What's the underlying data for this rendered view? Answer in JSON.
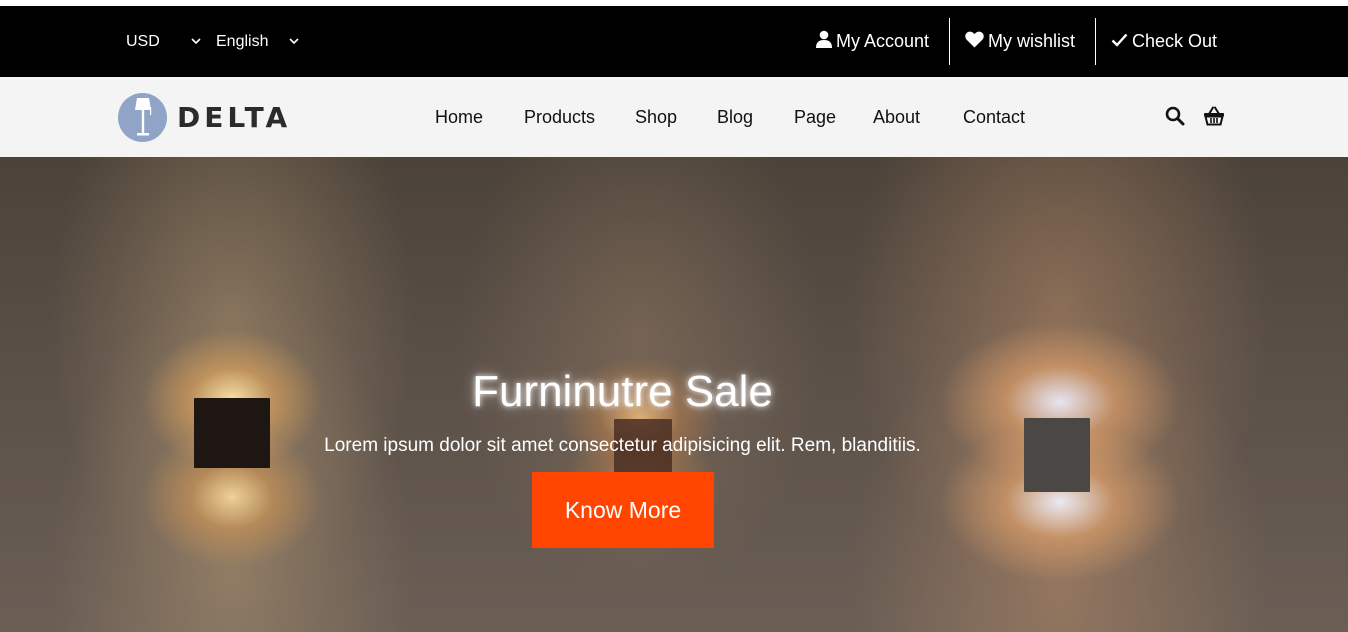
{
  "topbar": {
    "currency": "USD",
    "language": "English",
    "links": {
      "account": "My Account",
      "wishlist": "My wishlist",
      "checkout": "Check Out"
    }
  },
  "brand": {
    "name": "DELTA",
    "logo_color": "#8fa4c6"
  },
  "nav": {
    "items": [
      "Home",
      "Products",
      "Shop",
      "Blog",
      "Page",
      "About",
      "Contact"
    ]
  },
  "icons": {
    "search": "search-icon",
    "cart": "basket-icon",
    "account": "user-icon",
    "wishlist": "heart-icon",
    "checkout": "check-icon"
  },
  "hero": {
    "title": "Furninutre Sale",
    "subtitle": "Lorem ipsum dolor sit amet consectetur adipisicing elit. Rem, blanditiis.",
    "button_label": "Know More",
    "button_color": "#ff4500"
  }
}
